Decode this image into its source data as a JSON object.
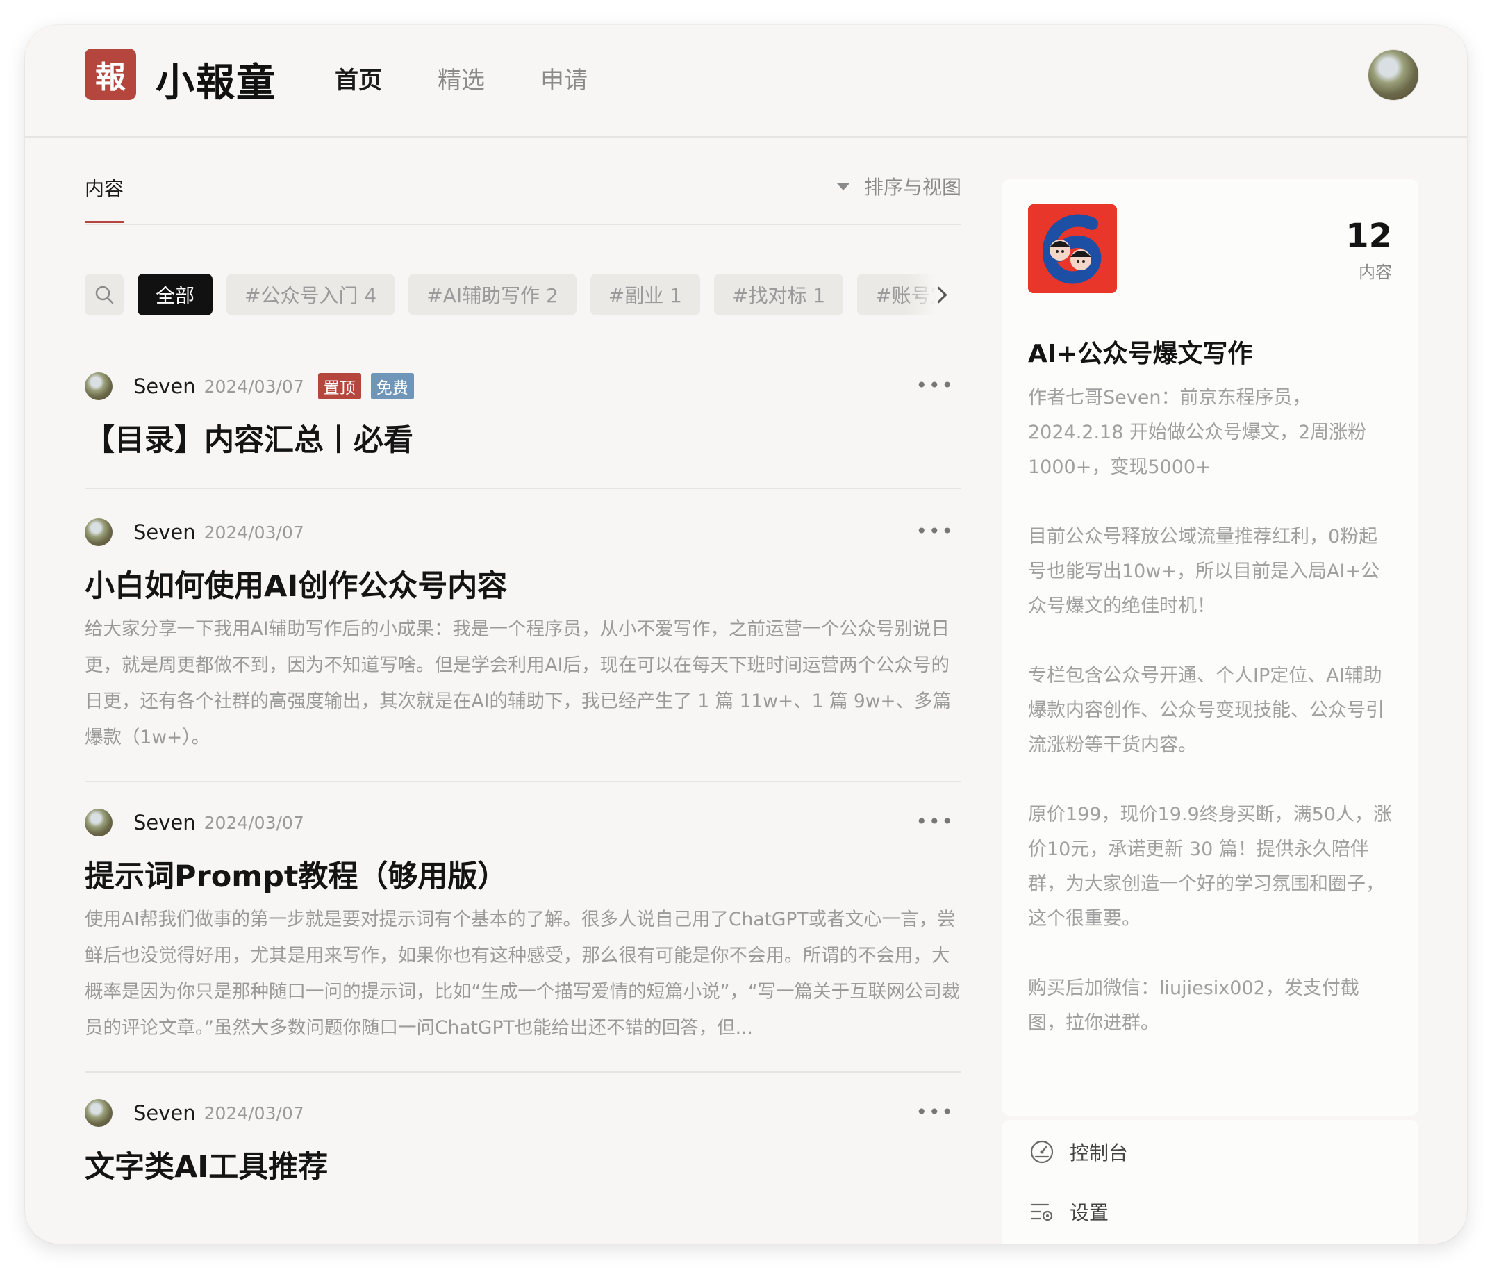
{
  "header": {
    "logo_char": "報",
    "brand": "小報童",
    "nav": [
      {
        "label": "首页",
        "active": true
      },
      {
        "label": "精选",
        "active": false
      },
      {
        "label": "申请",
        "active": false
      }
    ]
  },
  "main": {
    "tab_label": "内容",
    "sort_view_label": "排序与视图",
    "filters": [
      {
        "label": "全部",
        "active": true
      },
      {
        "label": "#公众号入门 4"
      },
      {
        "label": "#AI辅助写作 2"
      },
      {
        "label": "#副业 1"
      },
      {
        "label": "#找对标 1"
      },
      {
        "label": "#账号定位"
      }
    ],
    "posts": [
      {
        "author": "Seven",
        "date": "2024/03/07",
        "badge_pin": "置顶",
        "badge_free": "免费",
        "title": "【目录】内容汇总丨必看",
        "summary": ""
      },
      {
        "author": "Seven",
        "date": "2024/03/07",
        "title": "小白如何使用AI创作公众号内容",
        "summary": "给大家分享一下我用AI辅助写作后的小成果：我是一个程序员，从小不爱写作，之前运营一个公众号别说日更，就是周更都做不到，因为不知道写啥。但是学会利用AI后，现在可以在每天下班时间运营两个公众号的日更，还有各个社群的高强度输出，其次就是在AI的辅助下，我已经产生了 1 篇 11w+、1 篇 9w+、多篇爆款（1w+）。"
      },
      {
        "author": "Seven",
        "date": "2024/03/07",
        "title": "提示词Prompt教程（够用版）",
        "summary": "使用AI帮我们做事的第一步就是要对提示词有个基本的了解。很多人说自己用了ChatGPT或者文心一言，尝鲜后也没觉得好用，尤其是用来写作，如果你也有这种感受，那么很有可能是你不会用。所谓的不会用，大概率是因为你只是那种随口一问的提示词，比如“生成一个描写爱情的短篇小说”，“写一篇关于互联网公司裁员的评论文章。”虽然大多数问题你随口一问ChatGPT也能给出还不错的回答，但..."
      },
      {
        "author": "Seven",
        "date": "2024/03/07",
        "title": "文字类AI工具推荐",
        "summary": ""
      }
    ]
  },
  "sidebar": {
    "content_count": "12",
    "content_count_label": "内容",
    "column_title": "AI+公众号爆文写作",
    "description": [
      "作者七哥Seven：前京东程序员，2024.2.18 开始做公众号爆文，2周涨粉1000+，变现5000+",
      "目前公众号释放公域流量推荐红利，0粉起号也能写出10w+，所以目前是入局AI+公众号爆文的绝佳时机！",
      "专栏包含公众号开通、个人IP定位、AI辅助爆款内容创作、公众号变现技能、公众号引流涨粉等干货内容。",
      "原价199，现价19.9终身买断，满50人，涨价10元，承诺更新 30 篇！提供永久陪伴群，为大家创造一个好的学习氛围和圈子，这个很重要。",
      "购买后加微信：liujiesix002，发支付截图，拉你进群。"
    ],
    "menu": [
      {
        "label": "控制台",
        "icon": "dashboard-icon"
      },
      {
        "label": "设置",
        "icon": "settings-icon"
      }
    ]
  },
  "colors": {
    "accent": "#b5463e",
    "free_badge": "#6f96b8",
    "cover_red": "#e8362b"
  }
}
